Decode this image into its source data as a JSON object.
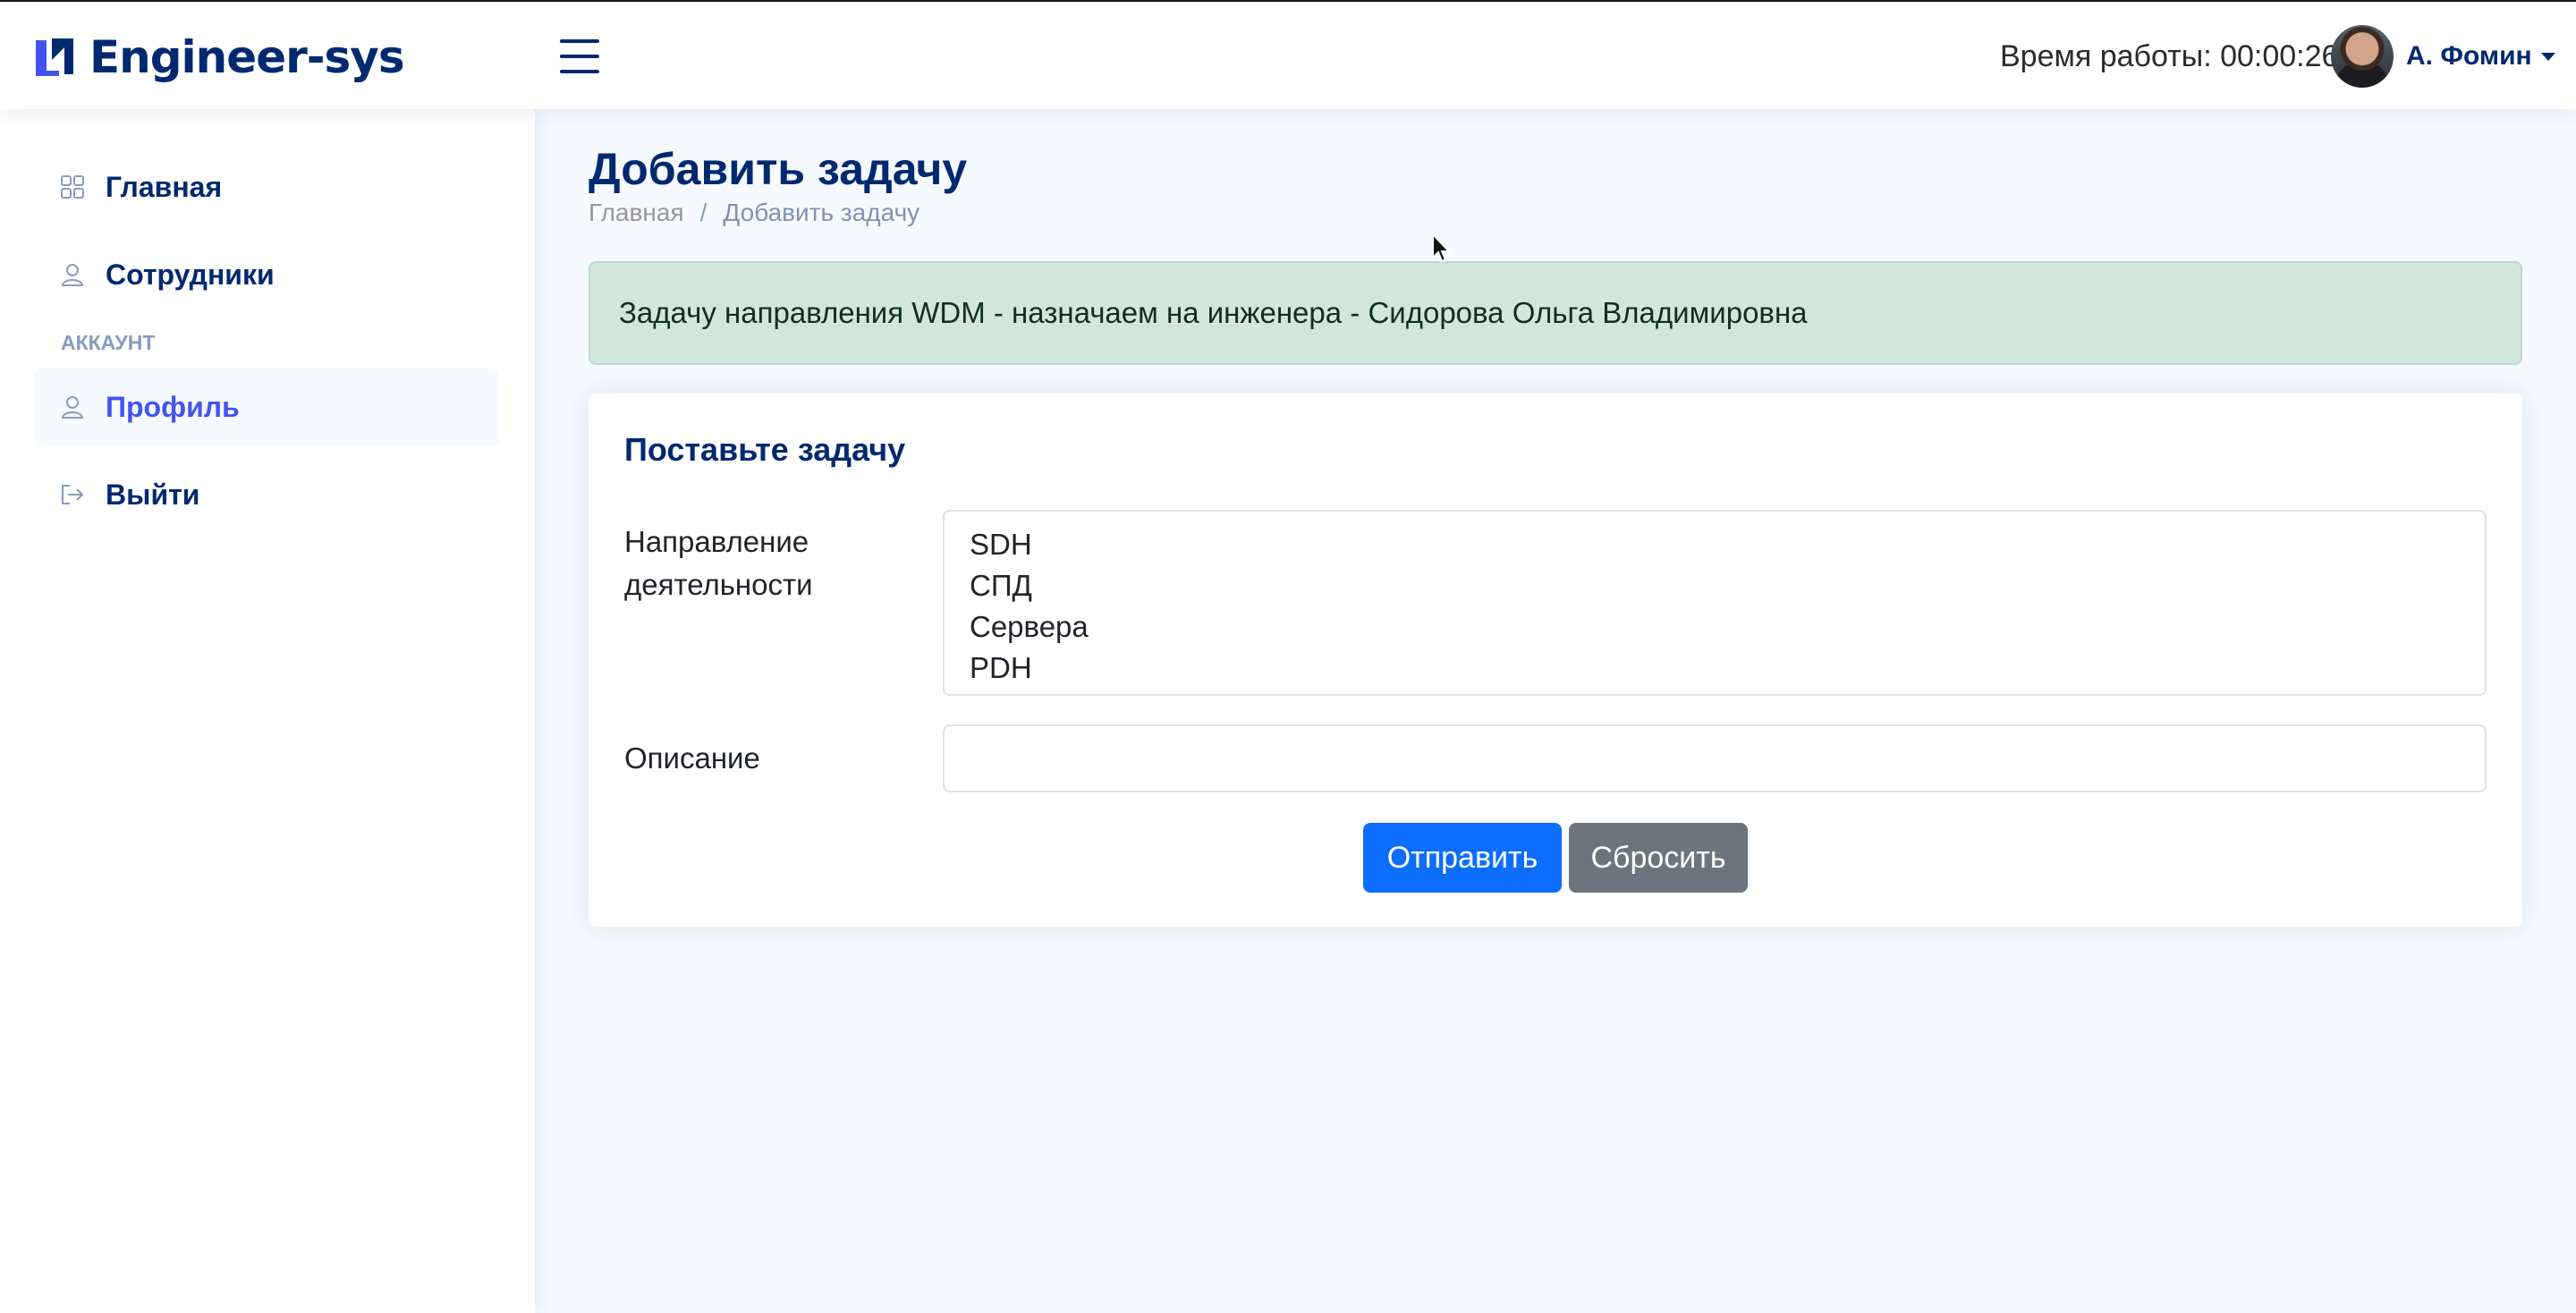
{
  "app": {
    "brand": "Engineer-sys",
    "brand_color": "#012970",
    "accent_color": "#4154f1"
  },
  "header": {
    "menu_icon": "hamburger-icon",
    "worktime": "Время работы: 00:00:26",
    "user_name": "А. Фомин",
    "avatar_icon": "user-avatar"
  },
  "sidebar": {
    "items": [
      {
        "label": "Главная",
        "icon": "grid-icon"
      },
      {
        "label": "Сотрудники",
        "icon": "person-icon"
      }
    ],
    "section_heading": "АККАУНТ",
    "account_items": [
      {
        "label": "Профиль",
        "icon": "person-icon",
        "active": true
      },
      {
        "label": "Выйти",
        "icon": "logout-icon"
      }
    ]
  },
  "page": {
    "title": "Добавить задачу",
    "breadcrumb": {
      "home": "Главная",
      "separator": "/",
      "current": "Добавить задачу"
    }
  },
  "alert": {
    "text": "Задачу направления WDM - назначаем на инженера - Сидорова Ольга Владимировна",
    "color": "#d1e7dd"
  },
  "form": {
    "title": "Поставьте задачу",
    "direction_label_line1": "Направление",
    "direction_label_line2": "деятельности",
    "direction_options": [
      "SDH",
      "СПД",
      "Сервера",
      "PDH"
    ],
    "description_label": "Описание",
    "description_value": "",
    "submit_label": "Отправить",
    "reset_label": "Сбросить",
    "submit_color": "#0d6efd",
    "reset_color": "#6c757d"
  }
}
